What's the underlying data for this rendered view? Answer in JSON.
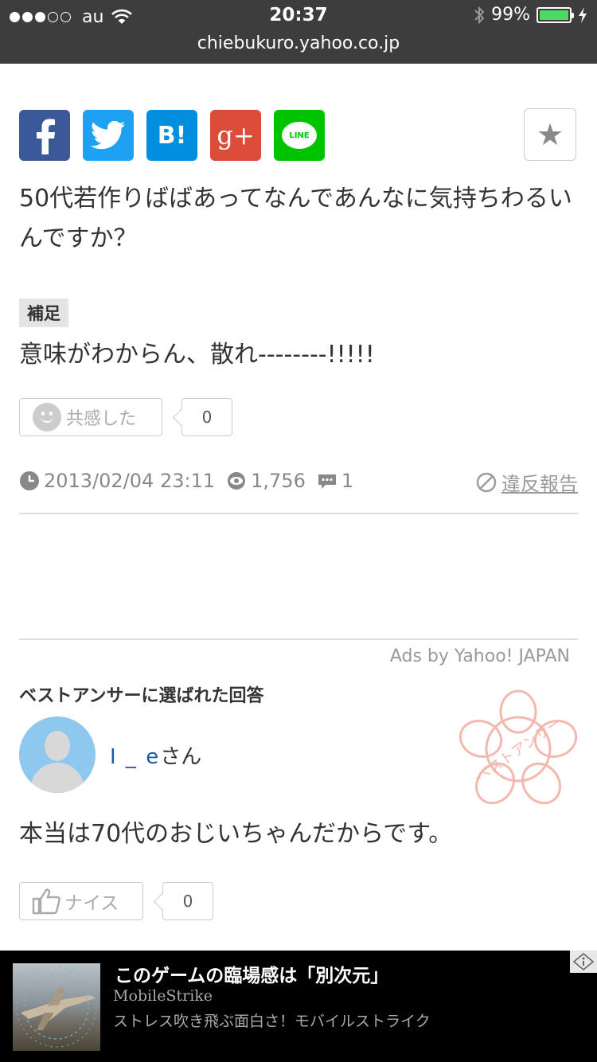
{
  "status_bar": {
    "carrier": "au",
    "time": "20:37",
    "battery": "99%",
    "battery_level": 0.99
  },
  "browser": {
    "url": "chiebukuro.yahoo.co.jp"
  },
  "share": {
    "hatena_label": "B!",
    "googleplus_label": "g+",
    "line_label": "LINE"
  },
  "question": {
    "text": "50代若作りばばあってなんであんなに気持ちわるいんですか？",
    "supplement_label": "補足",
    "supplement_text": "意味がわからん、散れ--------!!!!!",
    "empathy_label": "共感した",
    "empathy_count": "0",
    "date": "2013/02/04 23:11",
    "views": "1,756",
    "answers": "1",
    "report_label": "違反報告"
  },
  "ads_label": "Ads by Yahoo! JAPAN",
  "best_answer": {
    "section_title": "ベストアンサーに選ばれた回答",
    "username_fragment": "I        _   e",
    "honorific": "さん",
    "stamp_text": "ベストアンサー",
    "text": "本当は70代のおじいちゃんだからです。",
    "nice_label": "ナイス",
    "nice_count": "0"
  },
  "ad": {
    "title": "このゲームの臨場感は「別次元」",
    "source": "MobileStrike",
    "description": "ストレス吹き飛ぶ面白さ！モバイルストライク"
  }
}
